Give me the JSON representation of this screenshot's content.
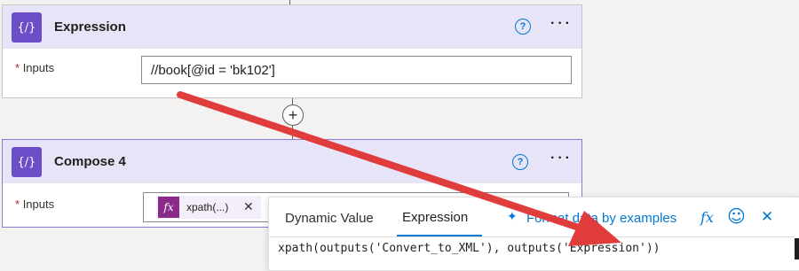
{
  "expression_card": {
    "title": "Expression",
    "inputs_label": "Inputs",
    "required_mark": "*",
    "input_value": "//book[@id = 'bk102']",
    "help_icon": "question-circle-icon",
    "more_icon": "ellipsis-icon",
    "action_icon": "curly-braces-icon",
    "action_icon_glyph": "{∕}"
  },
  "connector": {
    "add_icon": "plus-circle-icon",
    "add_glyph": "+"
  },
  "compose_card": {
    "title": "Compose 4",
    "inputs_label": "Inputs",
    "required_mark": "*",
    "token_label": "xpath(...)",
    "token_icon_label": "fx",
    "token_remove_glyph": "✕",
    "help_icon": "question-circle-icon",
    "more_icon": "ellipsis-icon",
    "action_icon": "curly-braces-icon",
    "action_icon_glyph": "{∕}"
  },
  "popup": {
    "tabs": [
      {
        "label": "Dynamic Value",
        "active": false
      },
      {
        "label": "Expression",
        "active": true
      }
    ],
    "format_link": "Format data by examples",
    "fx_glyph": "fx",
    "smile_glyph": "☺",
    "close_glyph": "✕",
    "expression_text": "xpath(outputs('Convert_to_XML'), outputs('Expression'))"
  },
  "colors": {
    "accent": "#6c4fc8",
    "header_bg": "#e8e4f7",
    "link": "#0078d4",
    "annotation_arrow": "#e03c3c"
  }
}
